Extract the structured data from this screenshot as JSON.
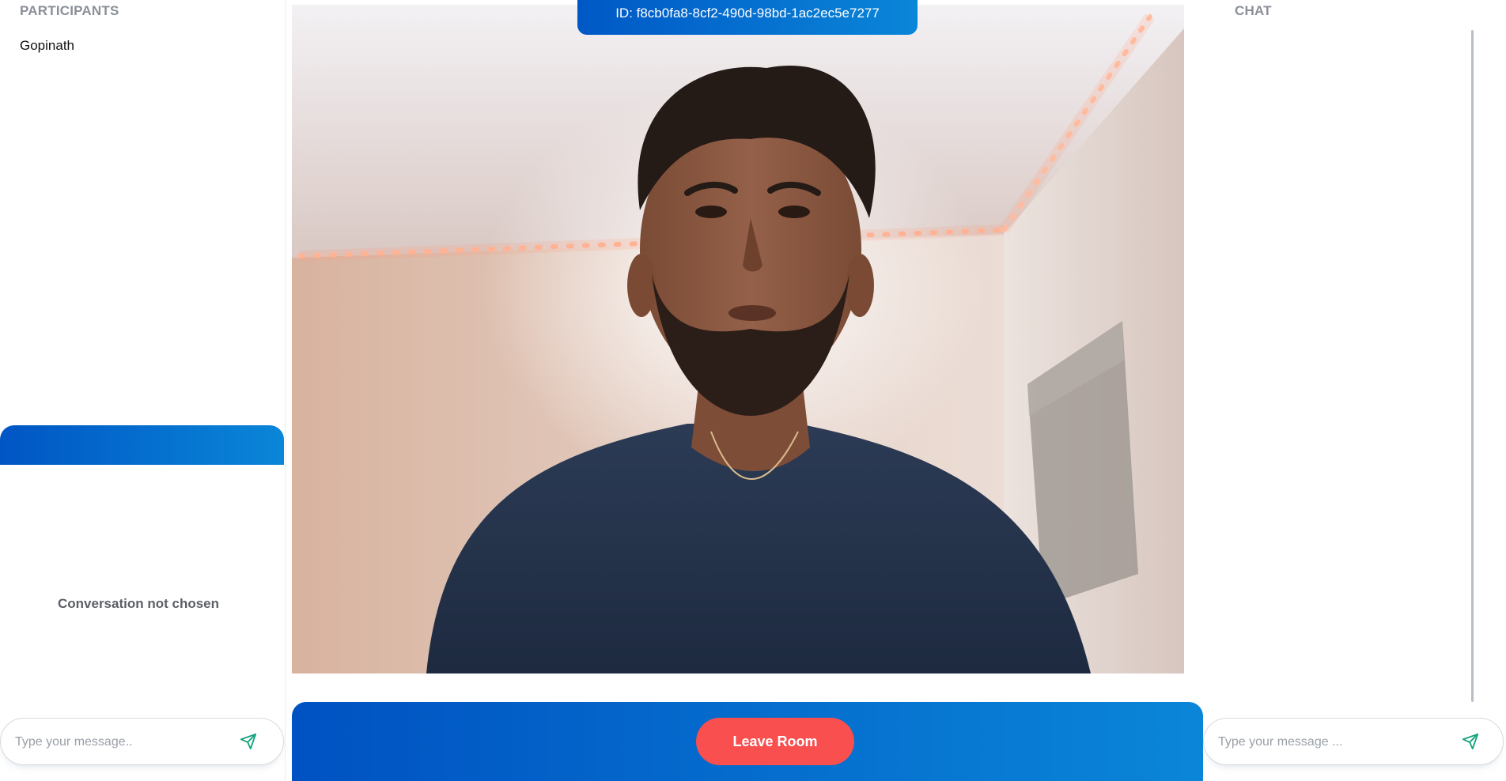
{
  "participants": {
    "title": "PARTICIPANTS",
    "list": [
      {
        "name": "Gopinath"
      }
    ]
  },
  "direct_messages": {
    "empty_state": "Conversation not chosen",
    "input_placeholder": "Type your message..",
    "send_icon": "send-icon"
  },
  "room": {
    "id_label": "ID: f8cb0fa8-8cf2-490d-98bd-1ac2ec5e7277",
    "leave_label": "Leave Room"
  },
  "chat": {
    "title": "CHAT",
    "input_placeholder": "Type your message ...",
    "send_icon": "send-icon"
  },
  "colors": {
    "brand_gradient_start": "#0055c4",
    "brand_gradient_end": "#0a86d8",
    "leave_button": "#f94f4f",
    "send_icon": "#16a37f",
    "section_title": "#8a8f98"
  }
}
